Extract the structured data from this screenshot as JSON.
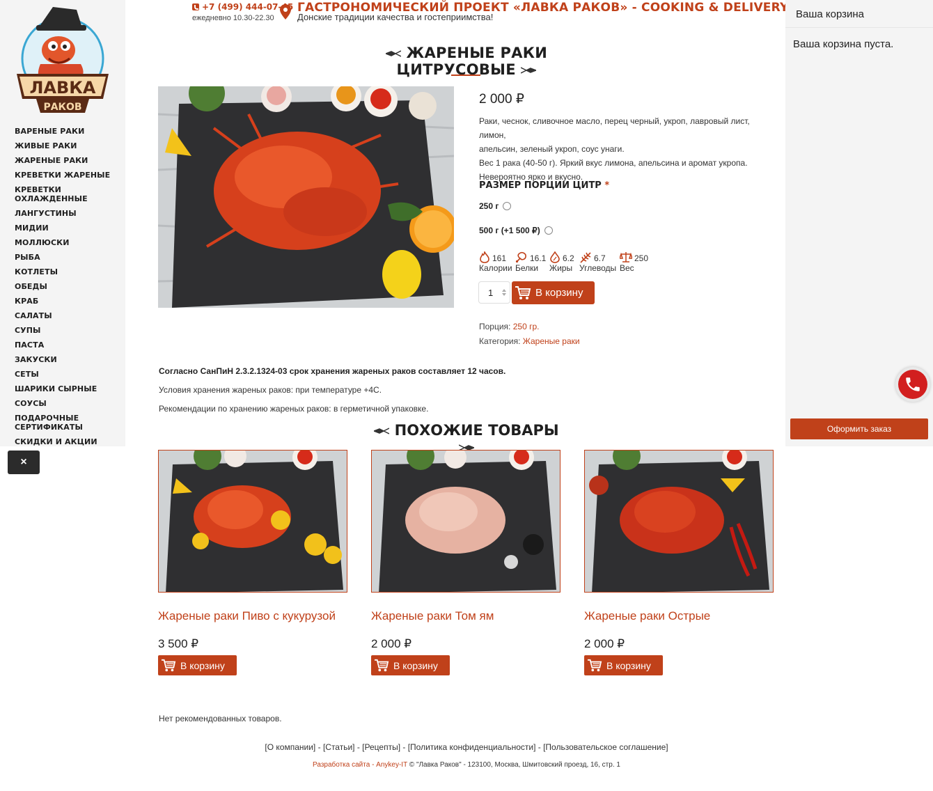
{
  "logo": {
    "top_text": "ЛАВКА",
    "bottom_text": "РАКОВ"
  },
  "menu": [
    "ВАРЕНЫЕ РАКИ",
    "ЖИВЫЕ РАКИ",
    "ЖАРЕНЫЕ РАКИ",
    "КРЕВЕТКИ ЖАРЕНЫЕ",
    "КРЕВЕТКИ ОХЛАЖДЕННЫЕ",
    "ЛАНГУСТИНЫ",
    "МИДИИ",
    "МОЛЛЮСКИ",
    "РЫБА",
    "КОТЛЕТЫ",
    "ОБЕДЫ",
    "КРАБ",
    "САЛАТЫ",
    "СУПЫ",
    "ПАСТА",
    "ЗАКУСКИ",
    "СЕТЫ",
    "ШАРИКИ СЫРНЫЕ",
    "СОУСЫ",
    "ПОДАРОЧНЫЕ СЕРТИФИКАТЫ",
    "СКИДКИ И АКЦИИ"
  ],
  "close_label": "×",
  "header": {
    "phone": "+7 (499) 444-07-45",
    "hours": "ежедневно 10.30-22.30",
    "title": "ГАСТРОНОМИЧЕСКИЙ ПРОЕКТ «ЛАВКА РАКОВ» - COOKING & DELIVERY",
    "subtitle": "Донские традиции качества и гостеприимства!"
  },
  "cart": {
    "heading": "Ваша корзина",
    "empty_text": "Ваша корзина пуста.",
    "checkout_label": "Оформить заказ"
  },
  "product": {
    "title": "ЖАРЕНЫЕ РАКИ ЦИТРУСОВЫЕ",
    "price": "2 000 ₽",
    "description": [
      "Раки, чеснок, сливочное масло, перец черный, укроп, лавровый лист, лимон,",
      "апельсин, зеленый укроп, соус унаги.",
      "Вес 1 рака (40-50 г). Яркий вкус лимона, апельсина и аромат укропа.",
      "Невероятно ярко и вкусно."
    ],
    "size_label": "РАЗМЕР ПОРЦИИ ЦИТР",
    "required_mark": "*",
    "options": [
      "250 г",
      "500 г  (+1 500 ₽)"
    ],
    "nutrition": [
      {
        "value": "161",
        "label": "Калории",
        "icon": "flame-icon"
      },
      {
        "value": "16.1",
        "label": "Белки",
        "icon": "meat-icon"
      },
      {
        "value": "6.2",
        "label": "Жиры",
        "icon": "drop-icon"
      },
      {
        "value": "6.7",
        "label": "Углеводы",
        "icon": "wheat-icon"
      },
      {
        "value": "250",
        "label": "Вес",
        "icon": "scales-icon"
      }
    ],
    "quantity": "1",
    "add_to_cart": "В корзину",
    "portion_label": "Порция:",
    "portion_value": "250 гр.",
    "category_label": "Категория:",
    "category_value": "Жареные раки"
  },
  "storage": {
    "bold": "Согласно СанПиН 2.3.2.1324-03 срок хранения жареных раков составляет 12 часов.",
    "conditions": "Условия хранения жареных раков: при температуре +4С.",
    "recommendation": "Рекомендации по хранению жареных раков: в герметичной упаковке."
  },
  "similar": {
    "title": "ПОХОЖИЕ ТОВАРЫ",
    "items": [
      {
        "name": "Жареные раки Пиво с кукурузой",
        "price": "3 500 ₽",
        "button": "В корзину"
      },
      {
        "name": "Жареные раки Том ям",
        "price": "2 000 ₽",
        "button": "В корзину"
      },
      {
        "name": "Жареные раки Острые",
        "price": "2 000 ₽",
        "button": "В корзину"
      }
    ]
  },
  "no_recommended": "Нет рекомендованных товаров.",
  "footer": {
    "links": [
      "[О компании]",
      "[Статьи]",
      "[Рецепты]",
      "[Политика конфиденциальности]",
      "[Пользовательское соглашение]"
    ],
    "separator": " - ",
    "developer": "Разработка сайта - Anykey-IT",
    "copyright": " © \"Лавка Раков\" - 123100, Москва, Шмитовский проезд, 16, стр. 1"
  },
  "colors": {
    "accent": "#c0411a",
    "sidebar_bg": "#f4f4f4",
    "call_red": "#d21f1f"
  }
}
